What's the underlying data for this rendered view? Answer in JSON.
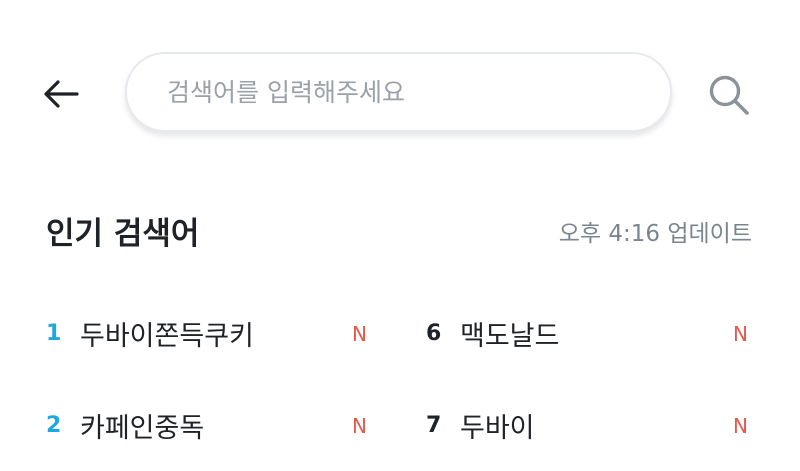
{
  "header": {
    "search_placeholder": "검색어를 입력해주세요"
  },
  "popular": {
    "title": "인기 검색어",
    "update_time": "오후 4:16 업데이트",
    "items": [
      {
        "rank": "1",
        "label": "두바이쫀득쿠키",
        "badge": "N"
      },
      {
        "rank": "2",
        "label": "카페인중독",
        "badge": "N"
      },
      {
        "rank": "6",
        "label": "맥도날드",
        "badge": "N"
      },
      {
        "rank": "7",
        "label": "두바이",
        "badge": "N"
      }
    ]
  },
  "colors": {
    "accent_rank": "#1fa7e0",
    "new_badge": "#e35a4b",
    "muted_text": "#7b8590"
  }
}
